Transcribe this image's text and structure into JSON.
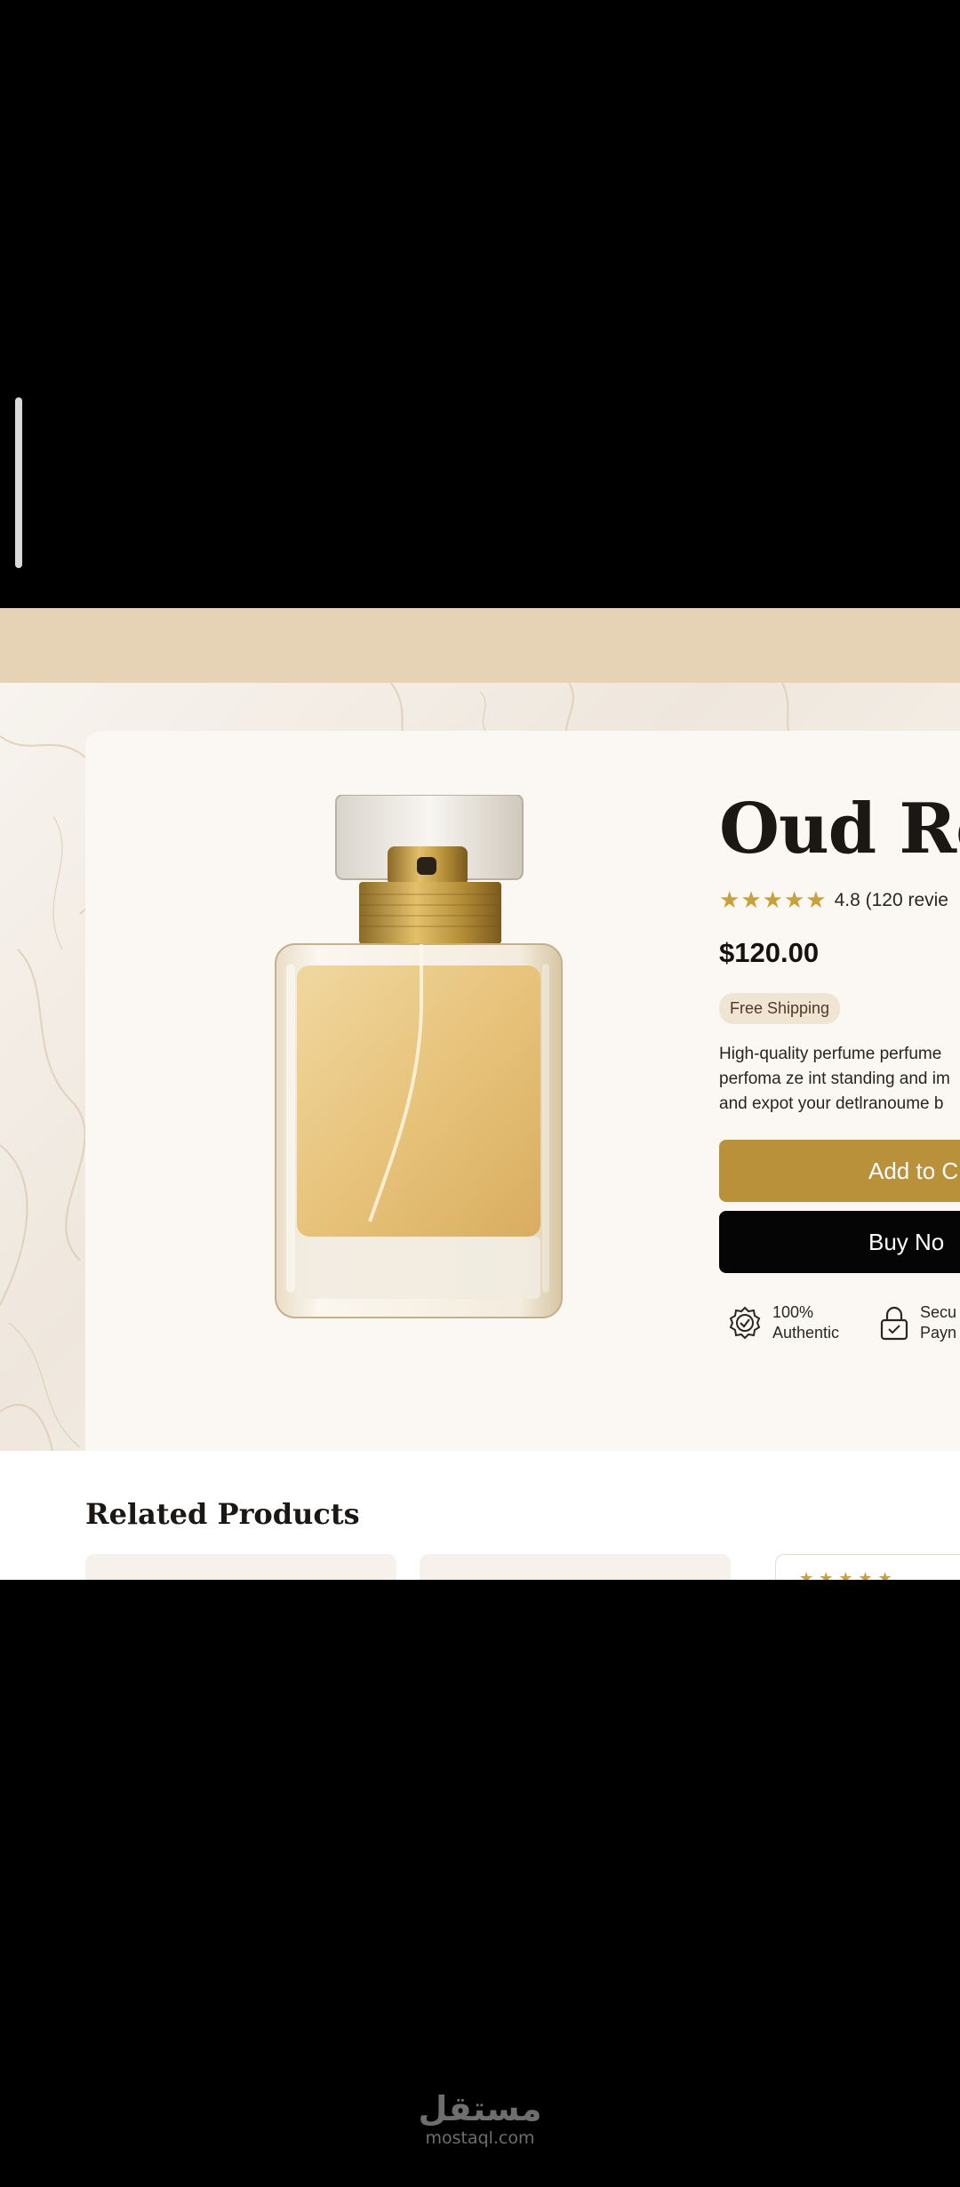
{
  "product": {
    "title": "Oud Ro",
    "rating_stars": 5,
    "rating_text": "4.8 (120 revie",
    "price": "$120.00",
    "shipping_badge": "Free Shipping",
    "description_lines": [
      "High-quality perfume perfume",
      "perfoma ze int standing and im",
      "and expot your detlranoume b"
    ],
    "add_to_cart_label": "Add to C",
    "buy_now_label": "Buy No",
    "features": [
      {
        "icon": "badge-check-icon",
        "line1": "100%",
        "line2": "Authentic"
      },
      {
        "icon": "lock-icon",
        "line1": "Secu",
        "line2": "Payn"
      }
    ]
  },
  "related": {
    "title": "Related Products",
    "stars_preview": "★★★★★"
  },
  "watermark": {
    "arabic": "مستقل",
    "latin": "mostaql.com"
  },
  "colors": {
    "accent_gold": "#b8913a",
    "star_gold": "#c9a13b",
    "band": "#e6d3b6",
    "button_dark": "#050505"
  }
}
